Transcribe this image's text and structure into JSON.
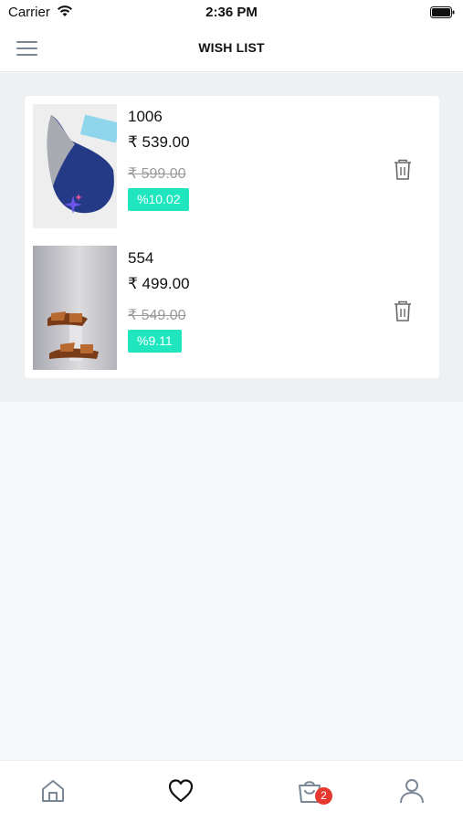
{
  "status_bar": {
    "carrier": "Carrier",
    "time": "2:36 PM"
  },
  "header": {
    "title": "WISH LIST",
    "menu_icon": "hamburger-icon"
  },
  "wishlist": {
    "items": [
      {
        "name": "1006",
        "price": "₹ 539.00",
        "original_price": "₹ 599.00",
        "discount": "%10.02",
        "image": "shoe-flat-image"
      },
      {
        "name": "554",
        "price": "₹ 499.00",
        "original_price": "₹ 549.00",
        "discount": "%9.11",
        "image": "sandal-image"
      }
    ]
  },
  "tabbar": {
    "tabs": [
      {
        "name": "home",
        "icon": "home-icon"
      },
      {
        "name": "wishlist",
        "icon": "heart-icon",
        "active": true
      },
      {
        "name": "cart",
        "icon": "shopping-bag-icon",
        "badge": "2"
      },
      {
        "name": "profile",
        "icon": "user-icon"
      }
    ]
  },
  "colors": {
    "accent": "#20e6c0",
    "badge": "#e5392f",
    "inactive_icon": "#7a8796",
    "background": "#eef0f2"
  }
}
